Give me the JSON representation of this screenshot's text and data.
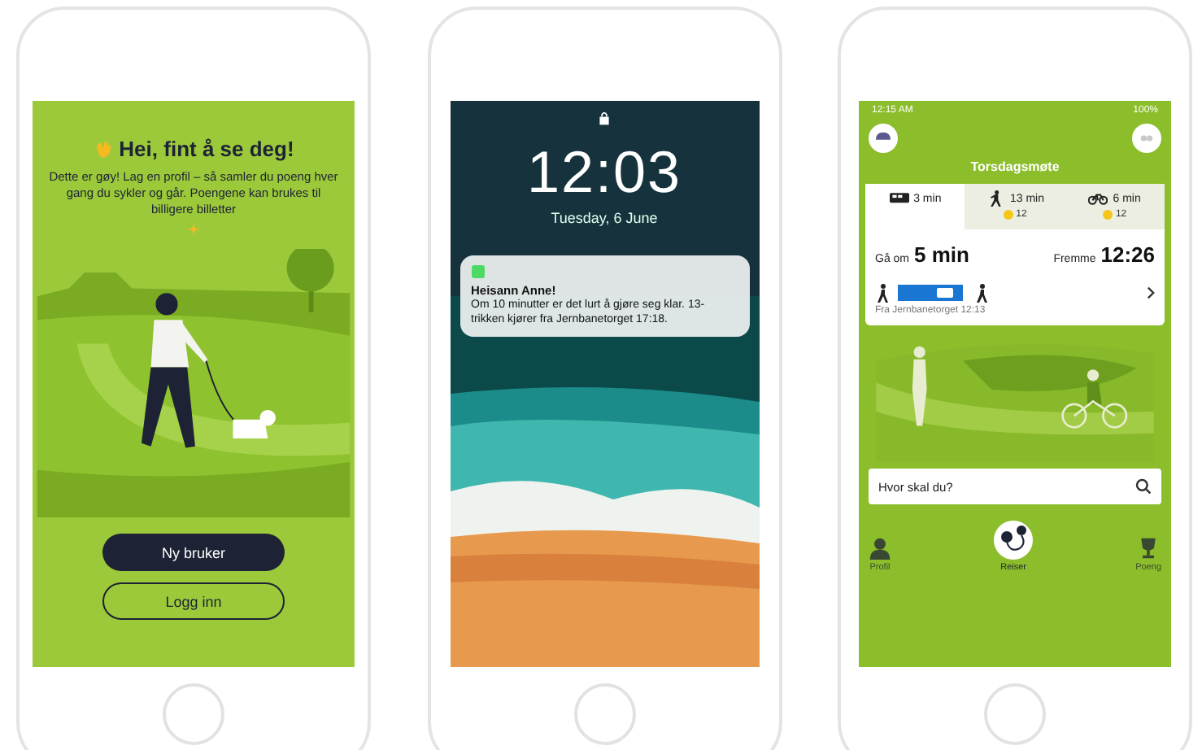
{
  "phones": [
    {
      "kind": "welcome",
      "greeting": "Hei, fint å se deg!",
      "body": "Dette er gøy! Lag en profil – så samler du poeng hver gang du sykler og går. Poengene kan brukes til billigere billetter",
      "buttons": [
        {
          "label": "Ny bruker",
          "kind": "primary"
        },
        {
          "label": "Logg inn",
          "kind": "outline"
        }
      ]
    },
    {
      "kind": "lockscreen",
      "time": "12:03",
      "date": "Tuesday, 6 June",
      "notification": {
        "title": "Heisann Anne!",
        "body": "Om 10 minutter er det lurt å gjøre seg klar. 13-trikken kjører fra Jernbanetorget 17:18."
      }
    },
    {
      "kind": "planner",
      "status": {
        "time": "12:15 AM",
        "battery": "100%"
      },
      "destination": "Torsdagsmøte",
      "modes": [
        {
          "kind": "bus",
          "label": "3 min",
          "selected": true
        },
        {
          "kind": "walk",
          "label": "13 min",
          "points": "12",
          "selected": false
        },
        {
          "kind": "bike",
          "label": "6 min",
          "points": "12",
          "selected": false
        }
      ],
      "depart_label": "Gå om",
      "depart_value": "5 min",
      "arrive_label": "Fremme",
      "arrive_value": "12:26",
      "route_note": "Fra Jernbanetorget 12:13",
      "search": {
        "placeholder": "Hvor skal du?"
      },
      "nav": [
        {
          "label": "Profil",
          "kind": "profile",
          "selected": false
        },
        {
          "label": "Reiser",
          "kind": "route",
          "selected": true
        },
        {
          "label": "Poeng",
          "kind": "trophy",
          "selected": false
        }
      ]
    }
  ]
}
